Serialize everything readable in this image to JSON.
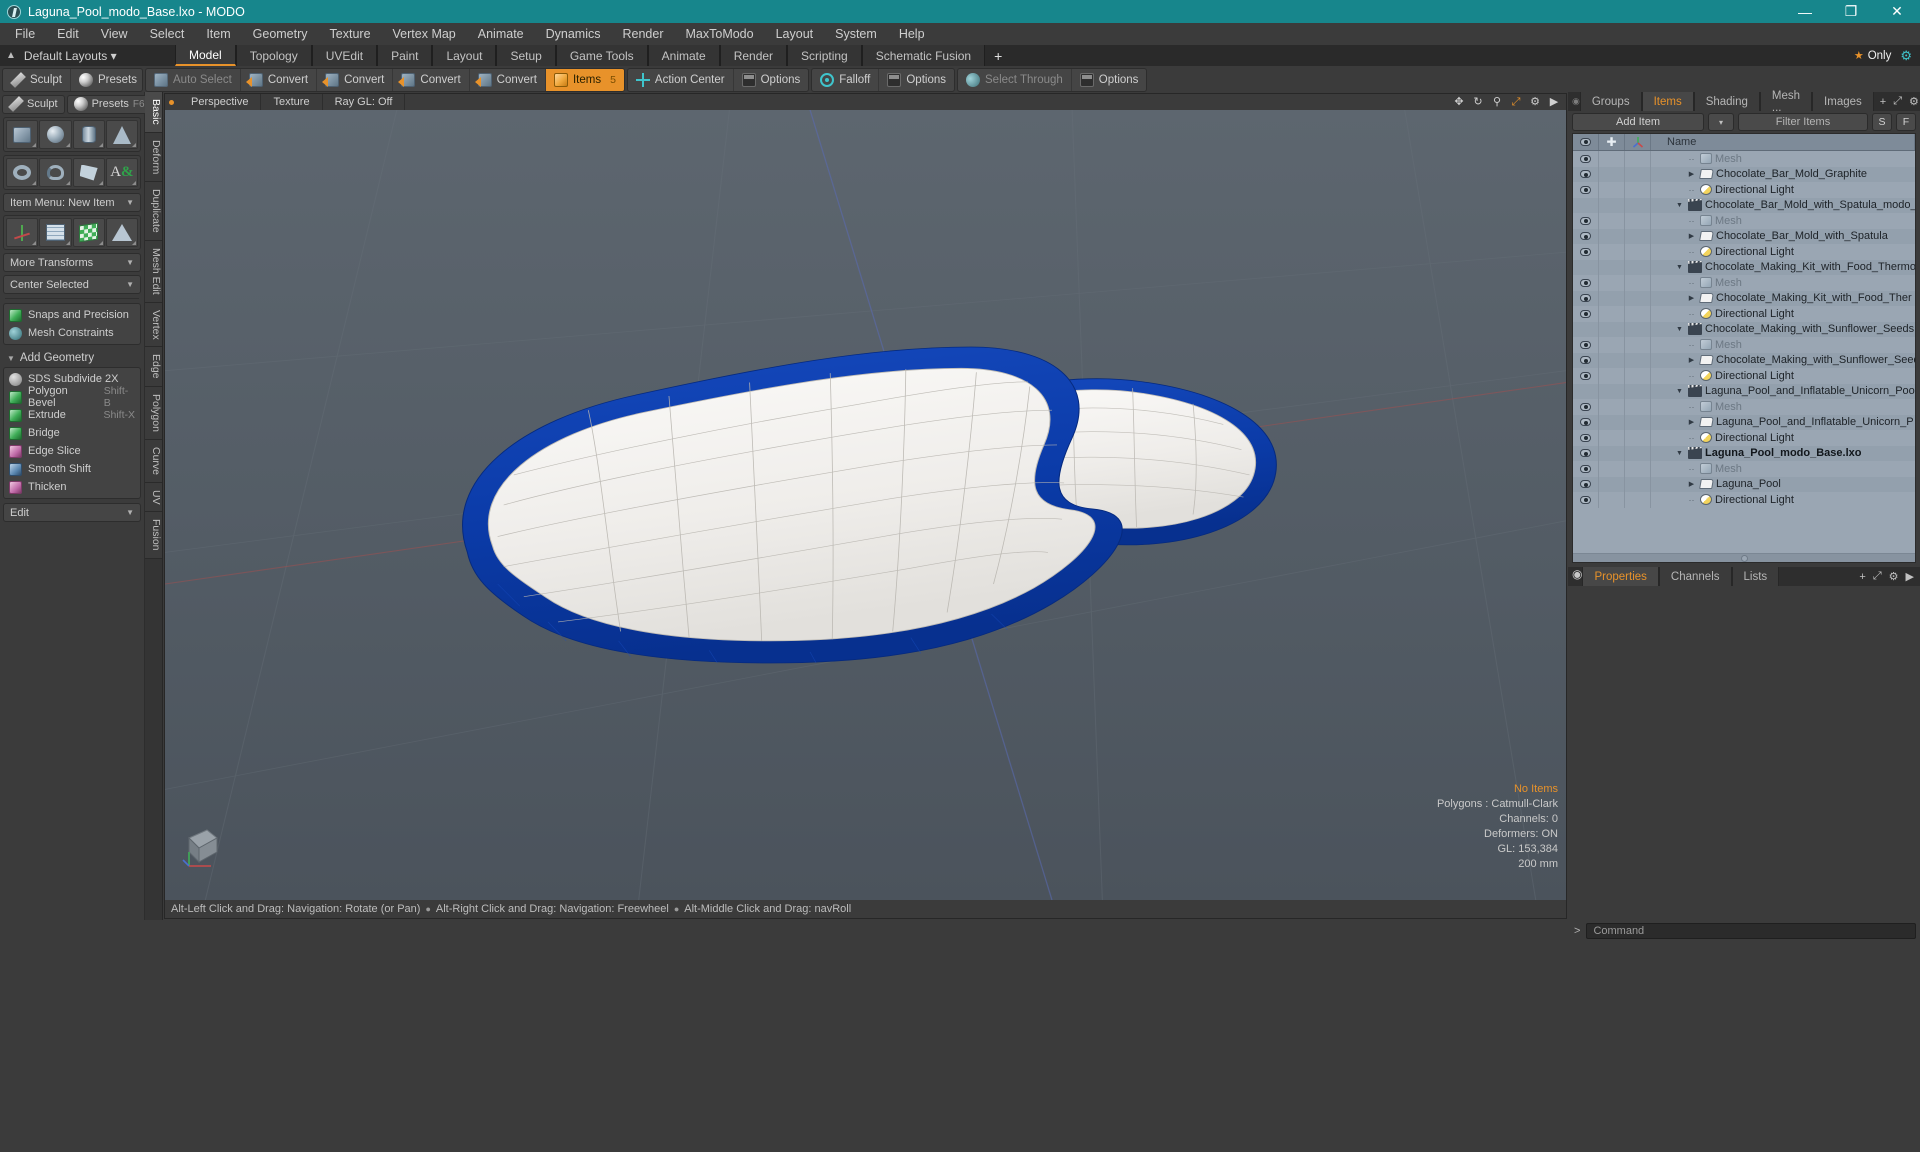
{
  "window": {
    "title": "Laguna_Pool_modo_Base.lxo - MODO",
    "app_icon": "modo-icon",
    "minimize": "—",
    "maximize": "❐",
    "close": "✕"
  },
  "menubar": {
    "items": [
      "File",
      "Edit",
      "View",
      "Select",
      "Item",
      "Geometry",
      "Texture",
      "Vertex Map",
      "Animate",
      "Dynamics",
      "Render",
      "MaxToModo",
      "Layout",
      "System",
      "Help"
    ]
  },
  "layoutbar": {
    "default_layouts": "Default Layouts",
    "caret": "▾",
    "tabs": [
      {
        "label": "Model",
        "active": true
      },
      {
        "label": "Topology",
        "active": false
      },
      {
        "label": "UVEdit",
        "active": false
      },
      {
        "label": "Paint",
        "active": false
      },
      {
        "label": "Layout",
        "active": false
      },
      {
        "label": "Setup",
        "active": false
      },
      {
        "label": "Game Tools",
        "active": false
      },
      {
        "label": "Animate",
        "active": false
      },
      {
        "label": "Render",
        "active": false
      },
      {
        "label": "Scripting",
        "active": false
      },
      {
        "label": "Schematic Fusion",
        "active": false
      }
    ],
    "add_tab": "+",
    "only_badge": "Only",
    "star": "★",
    "gear": "⚙"
  },
  "modebar": {
    "left_group": [
      {
        "label": "Sculpt",
        "icon": "pencil-icon",
        "shortcut": "",
        "state": "normal"
      },
      {
        "label": "Presets",
        "icon": "sphere-icon",
        "shortcut": "F6",
        "state": "normal"
      }
    ],
    "select_group": [
      {
        "label": "Auto Select",
        "icon": "cube-icon",
        "state": "dim"
      },
      {
        "label": "Convert",
        "icon": "convert-icon",
        "state": "normal"
      },
      {
        "label": "Convert",
        "icon": "convert-icon",
        "state": "normal"
      },
      {
        "label": "Convert",
        "icon": "convert-icon",
        "state": "normal"
      },
      {
        "label": "Convert",
        "icon": "convert-icon",
        "state": "normal"
      },
      {
        "label": "Items",
        "icon": "cube-orange-icon",
        "state": "active",
        "count": "5"
      }
    ],
    "action_group": [
      {
        "label": "Action Center",
        "icon": "crosshair-icon",
        "state": "normal"
      },
      {
        "label": "Options",
        "icon": "options-icon",
        "state": "normal"
      }
    ],
    "falloff_group": [
      {
        "label": "Falloff",
        "icon": "falloff-icon",
        "state": "normal"
      },
      {
        "label": "Options",
        "icon": "options-icon",
        "state": "normal"
      }
    ],
    "through_group": [
      {
        "label": "Select Through",
        "icon": "select-through-icon",
        "state": "dim"
      },
      {
        "label": "Options",
        "icon": "options-icon",
        "state": "normal"
      }
    ]
  },
  "left_toolbox": {
    "sculpt": {
      "label": "Sculpt",
      "icon": "pencil-icon"
    },
    "presets": {
      "label": "Presets",
      "shortcut": "F6",
      "icon": "sphere-icon"
    },
    "primitives_row1": [
      "cube-primitive",
      "sphere-primitive",
      "cylinder-primitive",
      "cone-primitive"
    ],
    "primitives_row2": [
      "torus-primitive",
      "spiral-primitive",
      "polygon-primitive",
      "text-primitive"
    ],
    "item_menu": "Item Menu: New Item",
    "transform_row": [
      "transform-axis-tool",
      "grid-plane-tool",
      "checker-plane-tool",
      "taper-tool"
    ],
    "more_transforms": "More Transforms",
    "center_selected": "Center Selected",
    "snaps": "Snaps and Precision",
    "mesh_constraints": "Mesh Constraints",
    "add_geometry_header": "Add Geometry",
    "add_geometry_items": [
      {
        "label": "SDS Subdivide 2X",
        "shortcut": "",
        "icon": "sds-icon"
      },
      {
        "label": "Polygon Bevel",
        "shortcut": "Shift-B",
        "icon": "bevel-icon"
      },
      {
        "label": "Extrude",
        "shortcut": "Shift-X",
        "icon": "extrude-icon"
      },
      {
        "label": "Bridge",
        "shortcut": "",
        "icon": "bridge-icon"
      },
      {
        "label": "Edge Slice",
        "shortcut": "",
        "icon": "edge-slice-icon"
      },
      {
        "label": "Smooth Shift",
        "shortcut": "",
        "icon": "smooth-shift-icon"
      },
      {
        "label": "Thicken",
        "shortcut": "",
        "icon": "thicken-icon"
      }
    ],
    "edit_dropdown": "Edit"
  },
  "vtabs": [
    {
      "label": "Basic",
      "active": true
    },
    {
      "label": "Deform",
      "active": false
    },
    {
      "label": "Duplicate",
      "active": false
    },
    {
      "label": "Mesh Edit",
      "active": false
    },
    {
      "label": "Vertex",
      "active": false
    },
    {
      "label": "Edge",
      "active": false
    },
    {
      "label": "Polygon",
      "active": false
    },
    {
      "label": "Curve",
      "active": false
    },
    {
      "label": "UV",
      "active": false
    },
    {
      "label": "Fusion",
      "active": false
    }
  ],
  "viewport": {
    "tabs": [
      "Perspective",
      "Texture",
      "Ray GL: Off"
    ],
    "icons": [
      "move-icon",
      "rotate-icon",
      "zoom-icon",
      "fit-icon",
      "gear-icon",
      "chevron-right-icon"
    ],
    "stats": {
      "no_items": "No Items",
      "polygons": "Polygons : Catmull-Clark",
      "channels": "Channels: 0",
      "deformers": "Deformers: ON",
      "gl": "GL: 153,384",
      "scale": "200 mm"
    },
    "status_hints": [
      "Alt-Left Click and Drag: Navigation: Rotate (or Pan)",
      "Alt-Right Click and Drag: Navigation: Freewheel",
      "Alt-Middle Click and Drag: navRoll"
    ],
    "status_sep": "●",
    "model_colors": {
      "pool_water": "#f2f0ec",
      "pool_rim": "#0b3ba8",
      "background_top": "#5b646d",
      "background_bottom": "#4d555e"
    }
  },
  "right_panel": {
    "tabs": [
      {
        "label": "Groups",
        "active": false
      },
      {
        "label": "Items",
        "active": true
      },
      {
        "label": "Shading",
        "active": false
      },
      {
        "label": "Mesh ...",
        "active": false
      },
      {
        "label": "Images",
        "active": false
      }
    ],
    "add_tab": "+",
    "icons": [
      "expand-icon",
      "gear-icon",
      "chevron-right-icon"
    ],
    "add_item": "Add Item",
    "add_item_caret": "▾",
    "filter_placeholder": "Filter Items",
    "s_button": "S",
    "f_button": "F",
    "columns": [
      "eye-column",
      "plus-column",
      "axis-column",
      "Name"
    ],
    "name_column_label": "Name",
    "items": [
      {
        "label": "Mesh",
        "icon": "mesh-icon",
        "depth": 2,
        "twisty": "dash",
        "visible": true,
        "style": "dim"
      },
      {
        "label": "Chocolate_Bar_Mold_Graphite",
        "icon": "folder-icon",
        "depth": 2,
        "twisty": "collapsed",
        "visible": true,
        "style": "normal"
      },
      {
        "label": "Directional Light",
        "icon": "light-icon",
        "depth": 2,
        "twisty": "dash",
        "visible": true,
        "style": "normal"
      },
      {
        "label": "Chocolate_Bar_Mold_with_Spatula_modo_ ...",
        "icon": "scene-icon",
        "depth": 1,
        "twisty": "expanded",
        "visible": false,
        "style": "normal"
      },
      {
        "label": "Mesh",
        "icon": "mesh-icon",
        "depth": 2,
        "twisty": "dash",
        "visible": true,
        "style": "dim"
      },
      {
        "label": "Chocolate_Bar_Mold_with_Spatula",
        "icon": "folder-icon",
        "depth": 2,
        "twisty": "collapsed",
        "visible": true,
        "style": "normal"
      },
      {
        "label": "Directional Light",
        "icon": "light-icon",
        "depth": 2,
        "twisty": "dash",
        "visible": true,
        "style": "normal"
      },
      {
        "label": "Chocolate_Making_Kit_with_Food_Thermo ...",
        "icon": "scene-icon",
        "depth": 1,
        "twisty": "expanded",
        "visible": false,
        "style": "normal"
      },
      {
        "label": "Mesh",
        "icon": "mesh-icon",
        "depth": 2,
        "twisty": "dash",
        "visible": true,
        "style": "dim"
      },
      {
        "label": "Chocolate_Making_Kit_with_Food_Ther ...",
        "icon": "folder-icon",
        "depth": 2,
        "twisty": "collapsed",
        "visible": true,
        "style": "normal"
      },
      {
        "label": "Directional Light",
        "icon": "light-icon",
        "depth": 2,
        "twisty": "dash",
        "visible": true,
        "style": "normal"
      },
      {
        "label": "Chocolate_Making_with_Sunflower_Seeds ...",
        "icon": "scene-icon",
        "depth": 1,
        "twisty": "expanded",
        "visible": false,
        "style": "normal"
      },
      {
        "label": "Mesh",
        "icon": "mesh-icon",
        "depth": 2,
        "twisty": "dash",
        "visible": true,
        "style": "dim"
      },
      {
        "label": "Chocolate_Making_with_Sunflower_Seeds",
        "icon": "folder-icon",
        "depth": 2,
        "twisty": "collapsed",
        "visible": true,
        "style": "normal"
      },
      {
        "label": "Directional Light",
        "icon": "light-icon",
        "depth": 2,
        "twisty": "dash",
        "visible": true,
        "style": "normal"
      },
      {
        "label": "Laguna_Pool_and_Inflatable_Unicorn_Pool ...",
        "icon": "scene-icon",
        "depth": 1,
        "twisty": "expanded",
        "visible": false,
        "style": "normal"
      },
      {
        "label": "Mesh",
        "icon": "mesh-icon",
        "depth": 2,
        "twisty": "dash",
        "visible": true,
        "style": "dim"
      },
      {
        "label": "Laguna_Pool_and_Inflatable_Unicorn_P ...",
        "icon": "folder-icon",
        "depth": 2,
        "twisty": "collapsed",
        "visible": true,
        "style": "normal"
      },
      {
        "label": "Directional Light",
        "icon": "light-icon",
        "depth": 2,
        "twisty": "dash",
        "visible": true,
        "style": "normal"
      },
      {
        "label": "Laguna_Pool_modo_Base.lxo",
        "icon": "scene-icon",
        "depth": 1,
        "twisty": "expanded",
        "visible": true,
        "style": "bold"
      },
      {
        "label": "Mesh",
        "icon": "mesh-icon",
        "depth": 2,
        "twisty": "dash",
        "visible": true,
        "style": "dim"
      },
      {
        "label": "Laguna_Pool",
        "icon": "folder-icon",
        "depth": 2,
        "twisty": "collapsed",
        "visible": true,
        "style": "normal"
      },
      {
        "label": "Directional Light",
        "icon": "light-icon",
        "depth": 2,
        "twisty": "dash",
        "visible": true,
        "style": "normal"
      }
    ],
    "properties_tabs": [
      {
        "label": "Properties",
        "active": true
      },
      {
        "label": "Channels",
        "active": false
      },
      {
        "label": "Lists",
        "active": false
      }
    ],
    "properties_add": "+"
  },
  "command_bar": {
    "prompt": ">",
    "placeholder": "Command"
  },
  "colors": {
    "titlebar": "#17868c",
    "accent": "#e8922a",
    "panel_bg": "#3b3b3b",
    "list_bg": "#9aa6b3",
    "pool_blue": "#0b3ba8"
  }
}
